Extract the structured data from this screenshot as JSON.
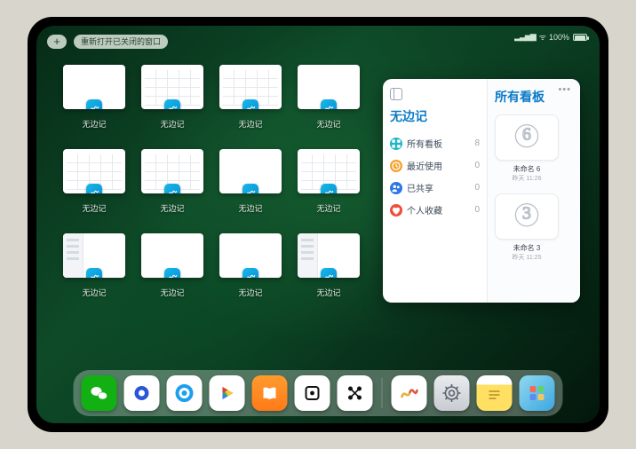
{
  "status": {
    "battery_pct": "100%"
  },
  "titlebar": {
    "plus": "+",
    "reopen": "重新打开已关闭的窗口"
  },
  "tile_label": "无边记",
  "tiles": [
    {
      "style": "blank"
    },
    {
      "style": "grid"
    },
    {
      "style": "grid"
    },
    {
      "style": "blank"
    },
    {
      "style": "grid"
    },
    {
      "style": "grid"
    },
    {
      "style": "blank"
    },
    {
      "style": "grid"
    },
    {
      "style": "sidebar"
    },
    {
      "style": "blank"
    },
    {
      "style": "blank"
    },
    {
      "style": "sidebar"
    }
  ],
  "freeform": {
    "sidebar_title": "无边记",
    "items": [
      {
        "icon": "grid",
        "color": "#1fb6c9",
        "label": "所有看板",
        "count": "8"
      },
      {
        "icon": "clock",
        "color": "#f4a12e",
        "label": "最近使用",
        "count": "0"
      },
      {
        "icon": "people",
        "color": "#2c78e4",
        "label": "已共享",
        "count": "0"
      },
      {
        "icon": "heart",
        "color": "#ef4e3c",
        "label": "个人收藏",
        "count": "0"
      }
    ],
    "main_title": "所有看板",
    "cards": [
      {
        "digit": "6",
        "caption": "未命名 6",
        "sub": "昨天 11:26"
      },
      {
        "digit": "3",
        "caption": "未命名 3",
        "sub": "昨天 11:25"
      }
    ]
  },
  "dock": [
    {
      "name": "wechat",
      "bg": "#12b012"
    },
    {
      "name": "browser-a",
      "bg": "#ffffff"
    },
    {
      "name": "browser-b",
      "bg": "#ffffff"
    },
    {
      "name": "play",
      "bg": "#ffffff"
    },
    {
      "name": "books",
      "bg": "linear-gradient(#ff9b2e,#ff7a18)"
    },
    {
      "name": "dice",
      "bg": "#ffffff"
    },
    {
      "name": "connect",
      "bg": "#ffffff"
    },
    {
      "name": "freeform",
      "bg": "#ffffff"
    },
    {
      "name": "settings",
      "bg": "linear-gradient(#e9ebee,#c8ccd2)"
    },
    {
      "name": "notes",
      "bg": "linear-gradient(#fff 0 26%,#ffe062 26% 100%)"
    },
    {
      "name": "library",
      "bg": "linear-gradient(135deg,#8fd8ef,#3da7e0)"
    }
  ]
}
